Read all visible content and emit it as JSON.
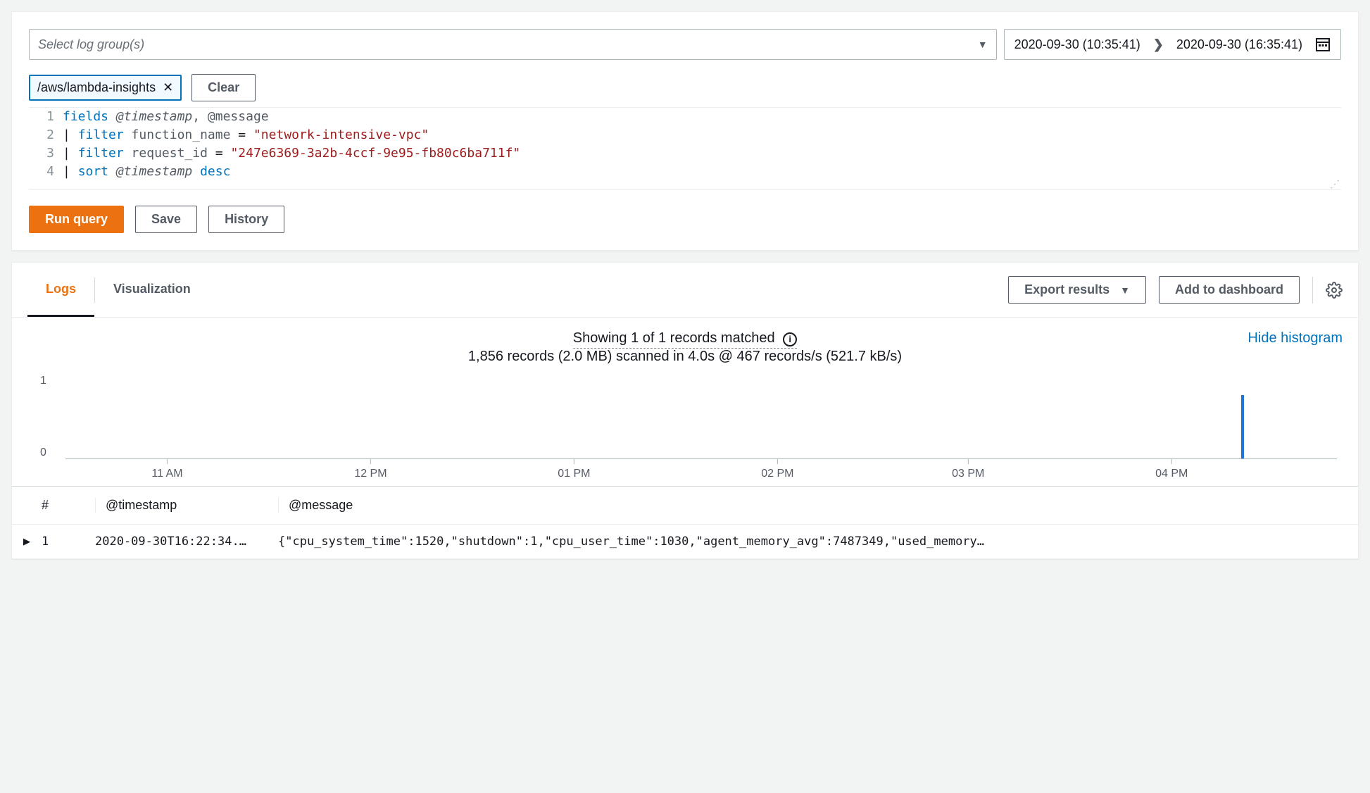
{
  "toolbar": {
    "select_placeholder": "Select log group(s)",
    "date_from": "2020-09-30 (10:35:41)",
    "date_to": "2020-09-30 (16:35:41)"
  },
  "chip": {
    "label": "/aws/lambda-insights"
  },
  "buttons": {
    "clear": "Clear",
    "run_query": "Run query",
    "save": "Save",
    "history": "History",
    "export_results": "Export results",
    "add_to_dashboard": "Add to dashboard"
  },
  "editor": {
    "lines": [
      {
        "n": "1",
        "kw1": "fields",
        "rest_ident": " @timestamp",
        "rest": ", @message"
      },
      {
        "n": "2",
        "pipe": "| ",
        "kw": "filter",
        "field": " function_name ",
        "eq": "= ",
        "str": "\"network-intensive-vpc\""
      },
      {
        "n": "3",
        "pipe": "| ",
        "kw": "filter",
        "field": " request_id ",
        "eq": "= ",
        "str": "\"247e6369-3a2b-4ccf-9e95-fb80c6ba711f\""
      },
      {
        "n": "4",
        "pipe": "| ",
        "kw": "sort",
        "ident": " @timestamp ",
        "kw2": "desc"
      }
    ]
  },
  "tabs": {
    "logs": "Logs",
    "visualization": "Visualization"
  },
  "summary": {
    "matched": "Showing 1 of 1 records matched",
    "scanned": "1,856 records (2.0 MB) scanned in 4.0s @ 467 records/s (521.7 kB/s)",
    "hide": "Hide histogram"
  },
  "chart_data": {
    "type": "bar",
    "ylim": [
      0,
      1
    ],
    "yticks": [
      "1",
      "0"
    ],
    "categories": [
      "11 AM",
      "12 PM",
      "01 PM",
      "02 PM",
      "03 PM",
      "04 PM"
    ],
    "bar_position_label": "~04:22 PM",
    "values": [
      0,
      0,
      0,
      0,
      0,
      1
    ]
  },
  "table": {
    "headers": {
      "num": "#",
      "ts": "@timestamp",
      "msg": "@message"
    },
    "rows": [
      {
        "num": "1",
        "ts": "2020-09-30T16:22:34.…",
        "msg": "{\"cpu_system_time\":1520,\"shutdown\":1,\"cpu_user_time\":1030,\"agent_memory_avg\":7487349,\"used_memory…"
      }
    ]
  }
}
